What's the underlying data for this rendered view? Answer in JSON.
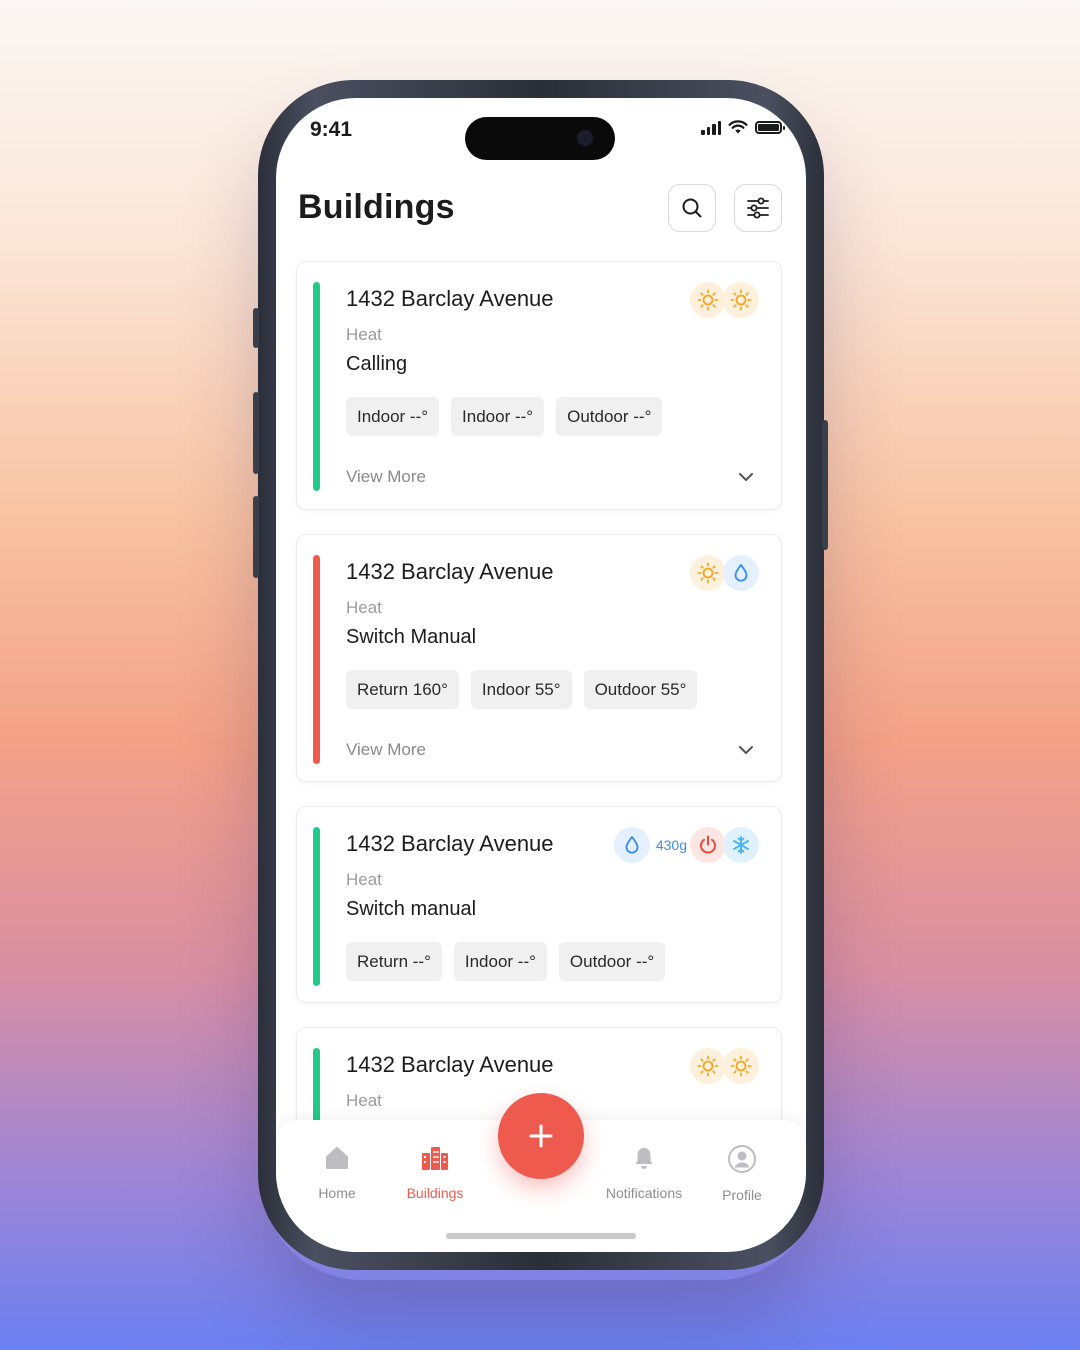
{
  "status_bar": {
    "time": "9:41"
  },
  "header": {
    "title": "Buildings"
  },
  "icons": {
    "search": "search-icon",
    "filter": "sliders-icon"
  },
  "colors": {
    "accent_green": "#22c98b",
    "accent_red": "#ef5a4f",
    "sun": "#f5a623",
    "water": "#3d8ef0",
    "power": "#ef4a3f",
    "snow": "#4ab4ee"
  },
  "cards": [
    {
      "title": "1432 Barclay Avenue",
      "subtitle": "Heat",
      "status": "Calling",
      "accent": "green",
      "badges": [
        "sun",
        "sun"
      ],
      "chips": [
        "Indoor --°",
        "Indoor --°",
        "Outdoor --°"
      ],
      "view_more": "View More"
    },
    {
      "title": "1432 Barclay Avenue",
      "subtitle": "Heat",
      "status": "Switch Manual",
      "accent": "red",
      "badges": [
        "sun",
        "water"
      ],
      "chips": [
        "Return 160°",
        "Indoor 55°",
        "Outdoor 55°"
      ],
      "view_more": "View More"
    },
    {
      "title": "1432 Barclay Avenue",
      "subtitle": "Heat",
      "status": "Switch manual",
      "accent": "green",
      "badges": [
        "water",
        "power",
        "snow"
      ],
      "badge_text": "430g",
      "chips": [
        "Return --°",
        "Indoor --°",
        "Outdoor --°"
      ]
    },
    {
      "title": "1432 Barclay Avenue",
      "subtitle": "Heat",
      "accent": "green",
      "badges": [
        "sun",
        "sun"
      ]
    }
  ],
  "tabbar": {
    "items": [
      {
        "label": "Home",
        "icon": "home-icon"
      },
      {
        "label": "Buildings",
        "icon": "buildings-icon",
        "active": true
      },
      {
        "label": "Notifications",
        "icon": "bell-icon"
      },
      {
        "label": "Profile",
        "icon": "profile-icon"
      }
    ],
    "fab_icon": "plus-icon"
  }
}
